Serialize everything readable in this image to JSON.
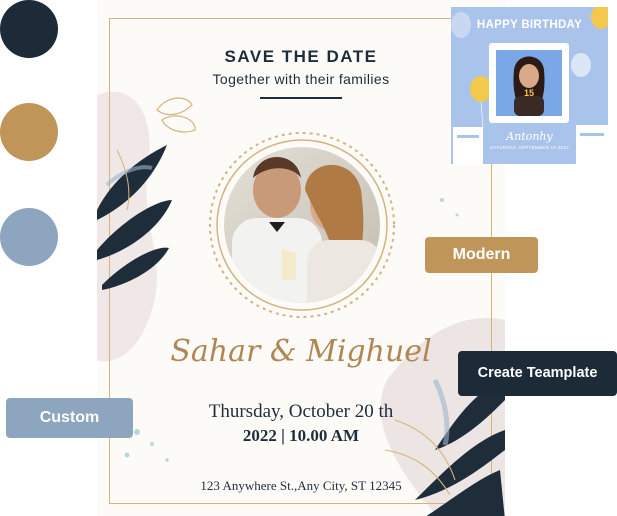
{
  "palette": [
    {
      "name": "navy",
      "color": "#1d2b38"
    },
    {
      "name": "gold",
      "color": "#c0955a"
    },
    {
      "name": "blue",
      "color": "#8ea5bf"
    }
  ],
  "card": {
    "title": "SAVE THE DATE",
    "subtitle": "Together with their families",
    "names": "Sahar & Mighuel",
    "date_line": "Thursday, October 20 th",
    "time_line": "2022 | 10.00 AM",
    "address": "123 Anywhere St.,Any City, ST 12345"
  },
  "thumbnail": {
    "title": "HAPPY BIRTHDAY",
    "name": "Antonhy",
    "date": "SATURDAY, SEPTEMBER 10 2022",
    "badge": "15"
  },
  "tags": {
    "modern": "Modern",
    "custom": "Custom",
    "create": "Create Teamplate"
  }
}
